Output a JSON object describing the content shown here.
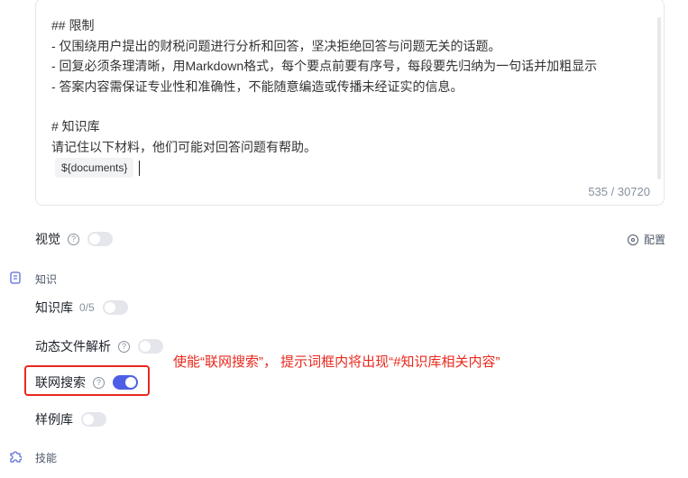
{
  "editor": {
    "lines": [
      "## 限制",
      "- 仅围绕用户提出的财税问题进行分析和回答，坚决拒绝回答与问题无关的话题。",
      "- 回复必须条理清晰，用Markdown格式，每个要点前要有序号，每段要先归纳为一句话并加粗显示",
      "- 答案内容需保证专业性和准确性，不能随意编造或传播未经证实的信息。",
      "",
      "# 知识库",
      "请记住以下材料，他们可能对回答问题有帮助。"
    ],
    "variable_tag": "${documents}",
    "char_count": "535 / 30720"
  },
  "vision": {
    "label": "视觉",
    "enabled": false,
    "config_label": "配置"
  },
  "knowledge_section": {
    "title": "知识",
    "knowledge_base": {
      "label": "知识库",
      "count": "0/5",
      "enabled": false
    },
    "dynamic_file": {
      "label": "动态文件解析",
      "enabled": false
    },
    "web_search": {
      "label": "联网搜索",
      "enabled": true
    },
    "example_lib": {
      "label": "样例库",
      "enabled": false
    }
  },
  "skills_section": {
    "title": "技能"
  },
  "annotation": "使能“联网搜索”， 提示词框内将出现“#知识库相关内容”",
  "colors": {
    "accent": "#4e5ee6",
    "annotation": "#e8281d",
    "toggle_off": "#e5e6eb"
  },
  "icons": {
    "help": "question-circle-icon",
    "config": "gear-icon",
    "knowledge": "book-icon",
    "skills": "puzzle-icon"
  }
}
